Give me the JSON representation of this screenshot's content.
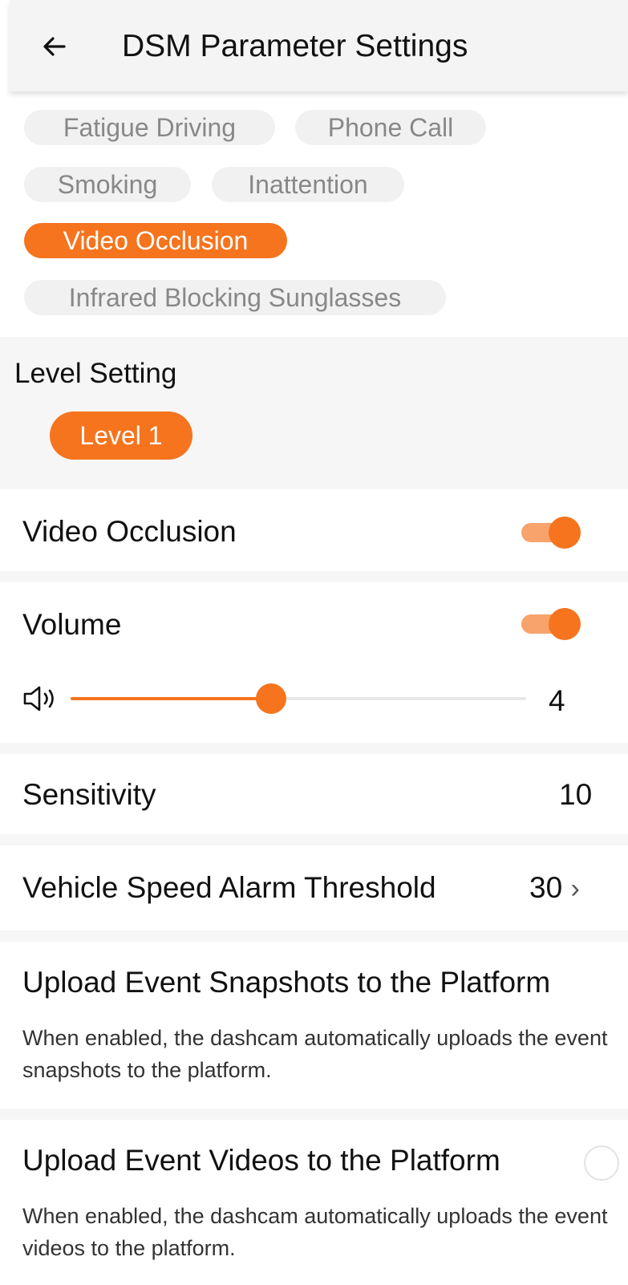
{
  "header": {
    "title": "DSM Parameter Settings"
  },
  "event_types": [
    {
      "label": "Fatigue Driving",
      "active": false
    },
    {
      "label": "Phone Call",
      "active": false
    },
    {
      "label": "Smoking",
      "active": false
    },
    {
      "label": "Inattention",
      "active": false
    },
    {
      "label": "Video Occlusion",
      "active": true
    },
    {
      "label": "Infrared Blocking Sunglasses",
      "active": false
    }
  ],
  "level_setting": {
    "title": "Level Setting",
    "selected": "Level 1"
  },
  "settings": {
    "video_occlusion": {
      "label": "Video Occlusion",
      "enabled": true
    },
    "volume": {
      "label": "Volume",
      "enabled": true,
      "value": "4",
      "fraction": 0.44
    },
    "sensitivity": {
      "label": "Sensitivity",
      "value": "10"
    },
    "speed_threshold": {
      "label": "Vehicle Speed Alarm Threshold",
      "value": "30",
      "chevron": "›"
    },
    "upload_snapshots": {
      "label": "Upload Event Snapshots to the Platform",
      "desc": "When enabled, the dashcam automatically uploads the event snapshots to the platform."
    },
    "upload_videos": {
      "label": "Upload Event Videos to the Platform",
      "enabled": false,
      "desc": "When enabled, the dashcam automatically uploads the event videos to the platform."
    }
  },
  "colors": {
    "accent": "#f5741d",
    "chip_bg": "#f1f1f1",
    "chip_text": "#888888"
  }
}
